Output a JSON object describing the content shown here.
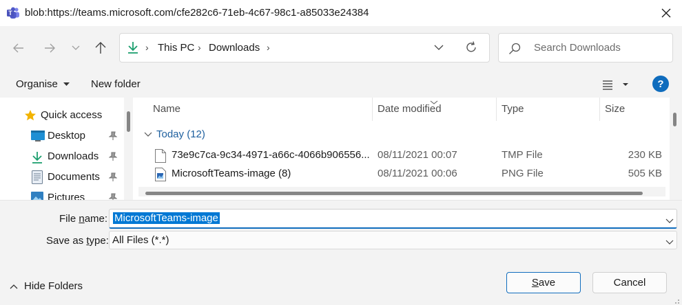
{
  "window": {
    "title": "blob:https://teams.microsoft.com/cfe282c6-71eb-4c67-98c1-a85033e24384",
    "app_icon": "teams-icon",
    "accent_color": "#0f6cbd"
  },
  "address_bar": {
    "breadcrumbs": [
      "This PC",
      "Downloads"
    ],
    "location_icon": "downloads-arrow-icon"
  },
  "search": {
    "placeholder": "Search Downloads"
  },
  "command_bar": {
    "organise_label": "Organise",
    "new_folder_label": "New folder",
    "help_label": "?"
  },
  "navigation_pane": {
    "items": [
      {
        "label": "Quick access",
        "icon": "star-icon",
        "pinned": false
      },
      {
        "label": "Desktop",
        "icon": "desktop-icon",
        "pinned": true
      },
      {
        "label": "Downloads",
        "icon": "downloads-arrow-icon",
        "pinned": true
      },
      {
        "label": "Documents",
        "icon": "documents-icon",
        "pinned": true
      },
      {
        "label": "Pictures",
        "icon": "pictures-icon",
        "pinned": true
      }
    ]
  },
  "file_list": {
    "columns": [
      "Name",
      "Date modified",
      "Type",
      "Size"
    ],
    "group_label": "Today (12)",
    "rows": [
      {
        "name": "73e9c7ca-9c34-4971-a66c-4066b906556...",
        "date_modified": "08/11/2021 00:07",
        "type": "TMP File",
        "size": "230 KB",
        "icon": "blank-file-icon"
      },
      {
        "name": "MicrosoftTeams-image (8)",
        "date_modified": "08/11/2021 00:06",
        "type": "PNG File",
        "size": "505 KB",
        "icon": "image-file-icon"
      }
    ]
  },
  "save_panel": {
    "file_name_label_prefix": "File ",
    "file_name_label_accel": "n",
    "file_name_label_suffix": "ame:",
    "file_name_value": "MicrosoftTeams-image",
    "save_type_label_prefix": "Save as ",
    "save_type_label_accel": "t",
    "save_type_label_suffix": "ype:",
    "save_type_value": "All Files (*.*)",
    "hide_folders_label": "Hide Folders",
    "save_accel": "S",
    "save_rest": "ave",
    "cancel_label": "Cancel"
  }
}
